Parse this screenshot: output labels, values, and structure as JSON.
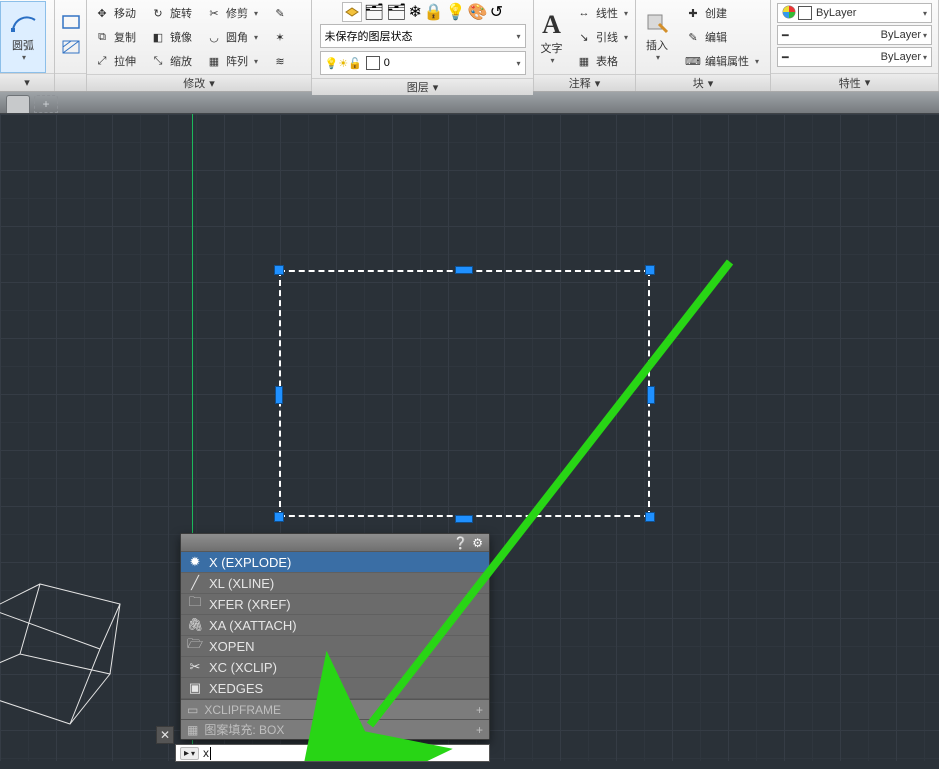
{
  "ribbon": {
    "arc_big_label": "圆弧",
    "modify": {
      "title": "修改",
      "move": "移动",
      "rotate": "旋转",
      "trim": "修剪",
      "copy": "复制",
      "mirror": "镜像",
      "fillet": "圆角",
      "stretch": "拉伸",
      "scale": "缩放",
      "array": "阵列"
    },
    "layer": {
      "title": "图层",
      "unsaved_state": "未保存的图层状态",
      "current_layer": "0"
    },
    "text_big_label": "文字",
    "annotate": {
      "title": "注释",
      "linear": "线性",
      "leader": "引线",
      "table": "表格"
    },
    "insert_big_label": "插入",
    "block": {
      "title": "块",
      "create": "创建",
      "edit": "编辑",
      "attr_edit": "编辑属性"
    },
    "properties": {
      "title": "特性",
      "color": "ByLayer",
      "linetype": "ByLayer",
      "lineweight": "ByLayer"
    }
  },
  "autocomplete": {
    "items": [
      {
        "icon": "explode",
        "text": "X (EXPLODE)",
        "selected": true
      },
      {
        "icon": "xline",
        "text": "XL (XLINE)"
      },
      {
        "icon": "xref",
        "text": "XFER (XREF)"
      },
      {
        "icon": "xattach",
        "text": "XA (XATTACH)"
      },
      {
        "icon": "xopen",
        "text": "XOPEN"
      },
      {
        "icon": "xclip",
        "text": "XC (XCLIP)"
      },
      {
        "icon": "xedges",
        "text": "XEDGES"
      }
    ],
    "section1": "XCLIPFRAME",
    "section2": "图案填充: BOX"
  },
  "commandline": {
    "prompt": ">_",
    "input_prefix": "x"
  }
}
